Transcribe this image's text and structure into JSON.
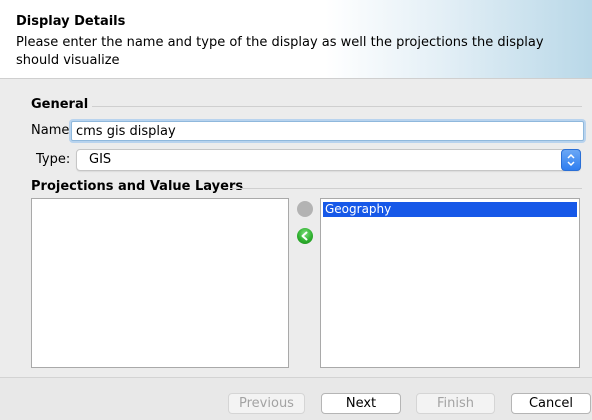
{
  "header": {
    "title": "Display Details",
    "description": "Please enter the name and type of the display as well the projections the display should visualize"
  },
  "general": {
    "section_title": "General",
    "name_label": "Name:",
    "name_value": "cms gis display",
    "type_label": "Type:",
    "type_value": "GIS"
  },
  "projections": {
    "section_title": "Projections and Value Layers",
    "available_items": [],
    "selected_items": [
      "Geography"
    ]
  },
  "buttons": {
    "previous": "Previous",
    "next": "Next",
    "finish": "Finish",
    "cancel": "Cancel"
  },
  "icons": {
    "add": "arrow-right-disabled-icon",
    "remove": "arrow-left-green-icon",
    "select_arrow": "up-down-arrows-icon"
  },
  "colors": {
    "selection": "#1658e8",
    "remove_button": "#2fb02f",
    "select_arrow": "#2f7ef0"
  }
}
